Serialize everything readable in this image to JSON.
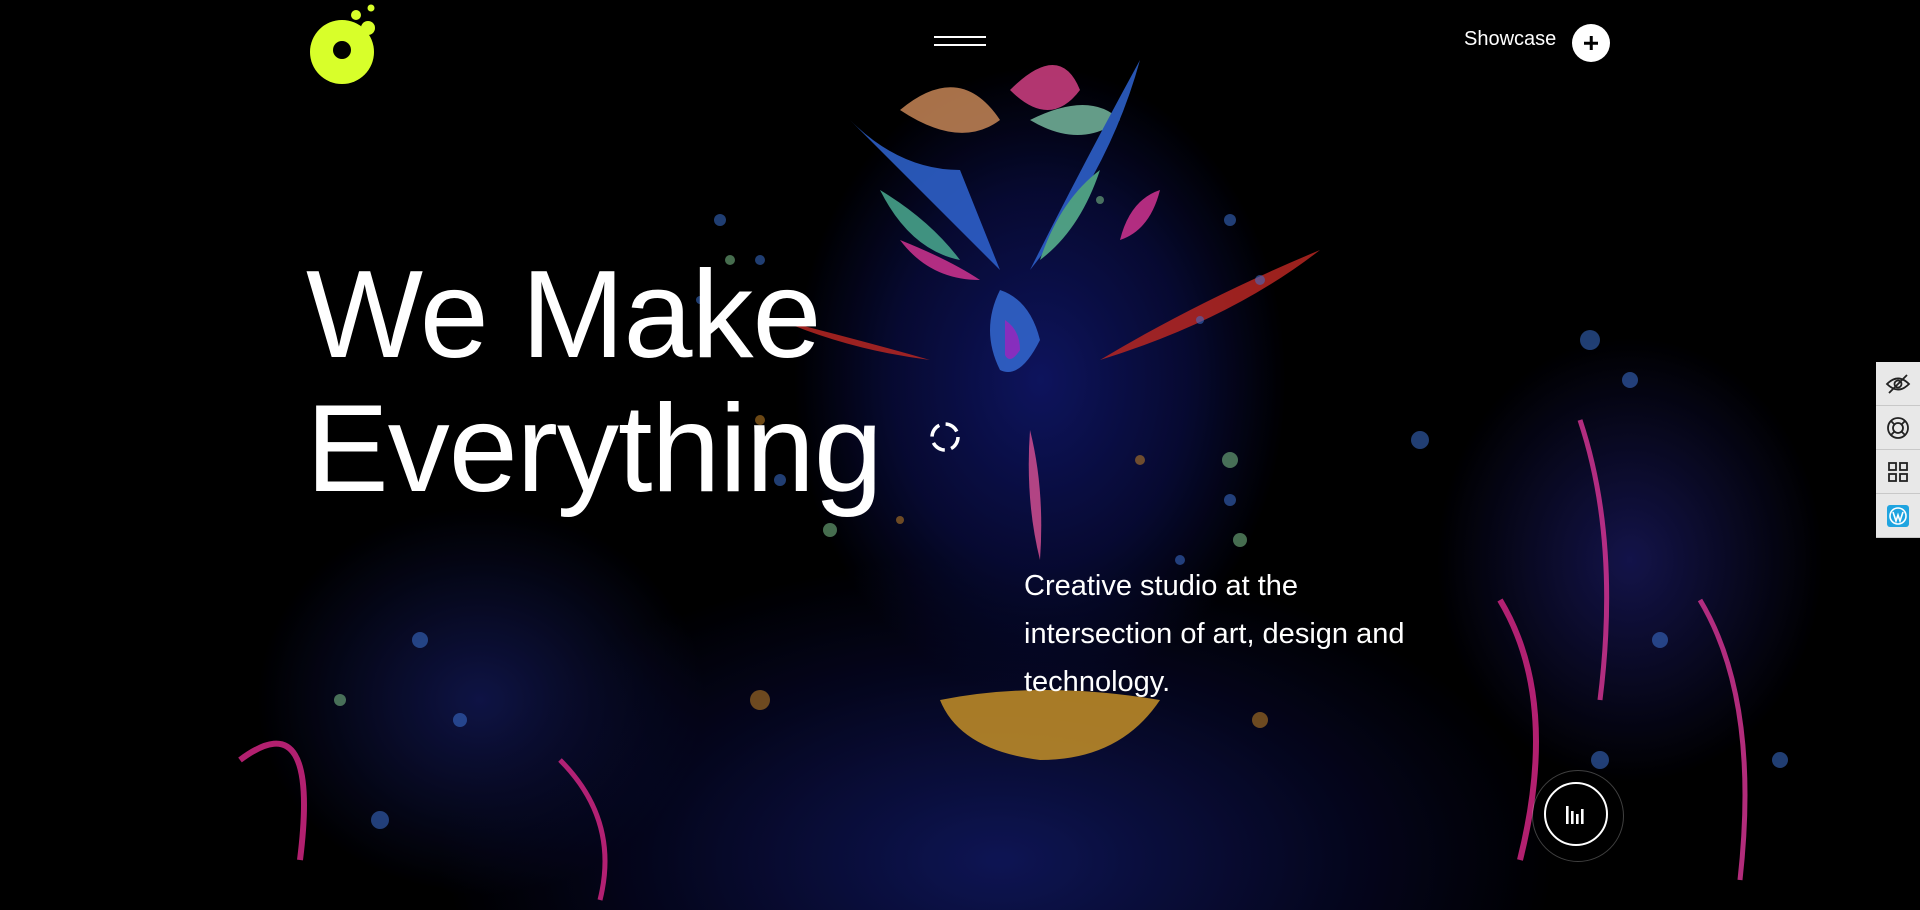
{
  "header": {
    "logo_icon": "logo-mark-icon",
    "accent_color": "#d8ff2a",
    "menu_icon": "hamburger-icon",
    "showcase_label": "Showcase",
    "showcase_icon": "plus-icon"
  },
  "hero": {
    "title_line1": "We Make",
    "title_line2": "Everything",
    "spinner_icon": "loading-spinner-icon",
    "tagline": "Creative studio at the intersection of art, design and technology."
  },
  "audio": {
    "icon": "audio-bars-icon"
  },
  "side_toolbar": {
    "items": [
      {
        "icon": "eye-off-icon"
      },
      {
        "icon": "lifebuoy-icon"
      },
      {
        "icon": "grid-icon"
      },
      {
        "icon": "wordpress-icon",
        "color": "#1fa4e0"
      }
    ]
  }
}
